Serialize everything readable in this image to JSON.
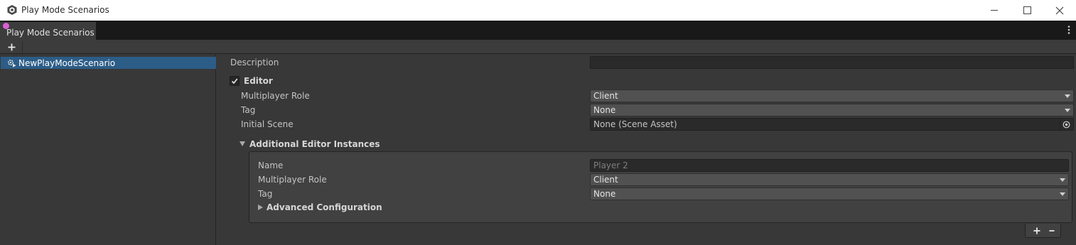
{
  "window": {
    "title": "Play Mode Scenarios",
    "icon": "unity-logo-icon"
  },
  "tabstrip": {
    "tab_label": "Play Mode Scenarios",
    "menu_icon": "kebab-menu-icon"
  },
  "toolbar": {
    "add_icon": "plus-icon"
  },
  "scenario_list": {
    "items": [
      {
        "label": "NewPlayModeScenario",
        "icon": "scenario-gear-icon",
        "selected": true
      }
    ]
  },
  "inspector": {
    "description": {
      "label": "Description",
      "value": ""
    },
    "editor": {
      "checked": true,
      "label": "Editor",
      "multiplayer_role": {
        "label": "Multiplayer Role",
        "value": "Client"
      },
      "tag": {
        "label": "Tag",
        "value": "None"
      },
      "initial_scene": {
        "label": "Initial Scene",
        "value": "None (Scene Asset)"
      }
    },
    "additional_instances": {
      "label": "Additional Editor Instances",
      "expanded": true,
      "items": [
        {
          "name": {
            "label": "Name",
            "placeholder": "Player 2"
          },
          "multiplayer_role": {
            "label": "Multiplayer Role",
            "value": "Client"
          },
          "tag": {
            "label": "Tag",
            "value": "None"
          },
          "advanced": {
            "label": "Advanced Configuration",
            "expanded": false
          }
        }
      ],
      "add_button": "+",
      "remove_button": "-"
    }
  },
  "colors": {
    "selection": "#2c5d87",
    "background": "#383838",
    "tabstrip": "#191919"
  }
}
